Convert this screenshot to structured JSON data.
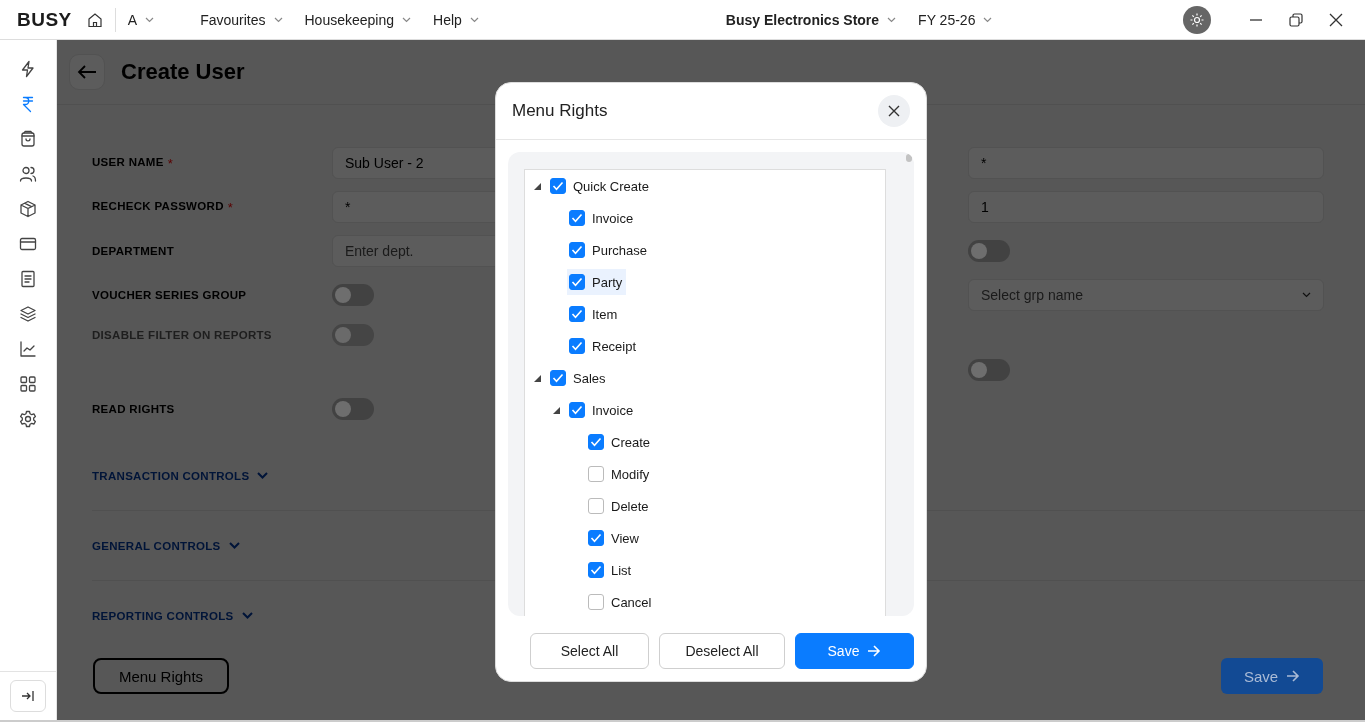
{
  "top_bar": {
    "logo": "BUSY",
    "company_code": "A",
    "menus": [
      "Favourites",
      "Housekeeping",
      "Help"
    ],
    "store": "Busy Electronics Store",
    "fiscal_year": "FY 25-26"
  },
  "sidebar": {
    "items": [
      {
        "selected": false
      },
      {
        "selected": true
      },
      {
        "selected": false
      },
      {
        "selected": false
      },
      {
        "selected": false
      },
      {
        "selected": false
      },
      {
        "selected": false
      },
      {
        "selected": false
      },
      {
        "selected": false
      },
      {
        "selected": false
      },
      {
        "selected": false
      }
    ]
  },
  "page": {
    "title": "Create User",
    "rows": [
      {
        "label": "USER NAME",
        "required": true,
        "disabled": false,
        "left": {
          "kind": "text",
          "value": "Sub User - 2"
        },
        "right": {
          "kind": "text",
          "value": "*"
        }
      },
      {
        "label": "RECHECK PASSWORD",
        "required": true,
        "disabled": false,
        "left": {
          "kind": "text",
          "value": "*"
        },
        "right": {
          "kind": "text",
          "value": "1"
        }
      },
      {
        "label": "DEPARTMENT",
        "required": false,
        "disabled": false,
        "left": {
          "kind": "text",
          "placeholder": "Enter dept."
        },
        "right": {
          "kind": "toggle",
          "on": false
        }
      },
      {
        "label": "VOUCHER SERIES GROUP",
        "required": false,
        "disabled": false,
        "left": {
          "kind": "toggle",
          "on": false
        },
        "right": {
          "kind": "select",
          "placeholder": "Select grp name"
        }
      },
      {
        "label": "DISABLE FILTER ON REPORTS",
        "required": false,
        "disabled": true,
        "left": {
          "kind": "toggle",
          "on": false
        }
      },
      {
        "right": {
          "kind": "toggle",
          "on": false
        }
      },
      {
        "label": "READ RIGHTS",
        "required": false,
        "disabled": false,
        "left": {
          "kind": "toggle",
          "on": false
        }
      }
    ],
    "sections": [
      {
        "label": "TRANSACTION CONTROLS",
        "expanded": false
      },
      {
        "label": "GENERAL CONTROLS",
        "expanded": false
      },
      {
        "label": "REPORTING CONTROLS",
        "expanded": false
      }
    ],
    "menu_rights_button": "Menu Rights",
    "save_button": "Save"
  },
  "dialog": {
    "title": "Menu Rights",
    "tree": [
      {
        "label": "Quick Create",
        "checked": true,
        "expanded": true,
        "selected": false,
        "children": [
          {
            "label": "Invoice",
            "checked": true,
            "selected": false
          },
          {
            "label": "Purchase",
            "checked": true,
            "selected": false
          },
          {
            "label": "Party",
            "checked": true,
            "selected": true
          },
          {
            "label": "Item",
            "checked": true,
            "selected": false
          },
          {
            "label": "Receipt",
            "checked": true,
            "selected": false
          }
        ]
      },
      {
        "label": "Sales",
        "checked": true,
        "expanded": true,
        "selected": false,
        "children": [
          {
            "label": "Invoice",
            "checked": true,
            "expanded": true,
            "selected": false,
            "children": [
              {
                "label": "Create",
                "checked": true,
                "selected": false
              },
              {
                "label": "Modify",
                "checked": false,
                "selected": false
              },
              {
                "label": "Delete",
                "checked": false,
                "selected": false
              },
              {
                "label": "View",
                "checked": true,
                "selected": false
              },
              {
                "label": "List",
                "checked": true,
                "selected": false
              },
              {
                "label": "Cancel",
                "checked": false,
                "selected": false
              }
            ]
          }
        ]
      }
    ],
    "buttons": [
      {
        "kind": "plain",
        "label": "Select All"
      },
      {
        "kind": "plain",
        "label": "Deselect All"
      },
      {
        "kind": "primary",
        "label": "Save"
      }
    ]
  }
}
